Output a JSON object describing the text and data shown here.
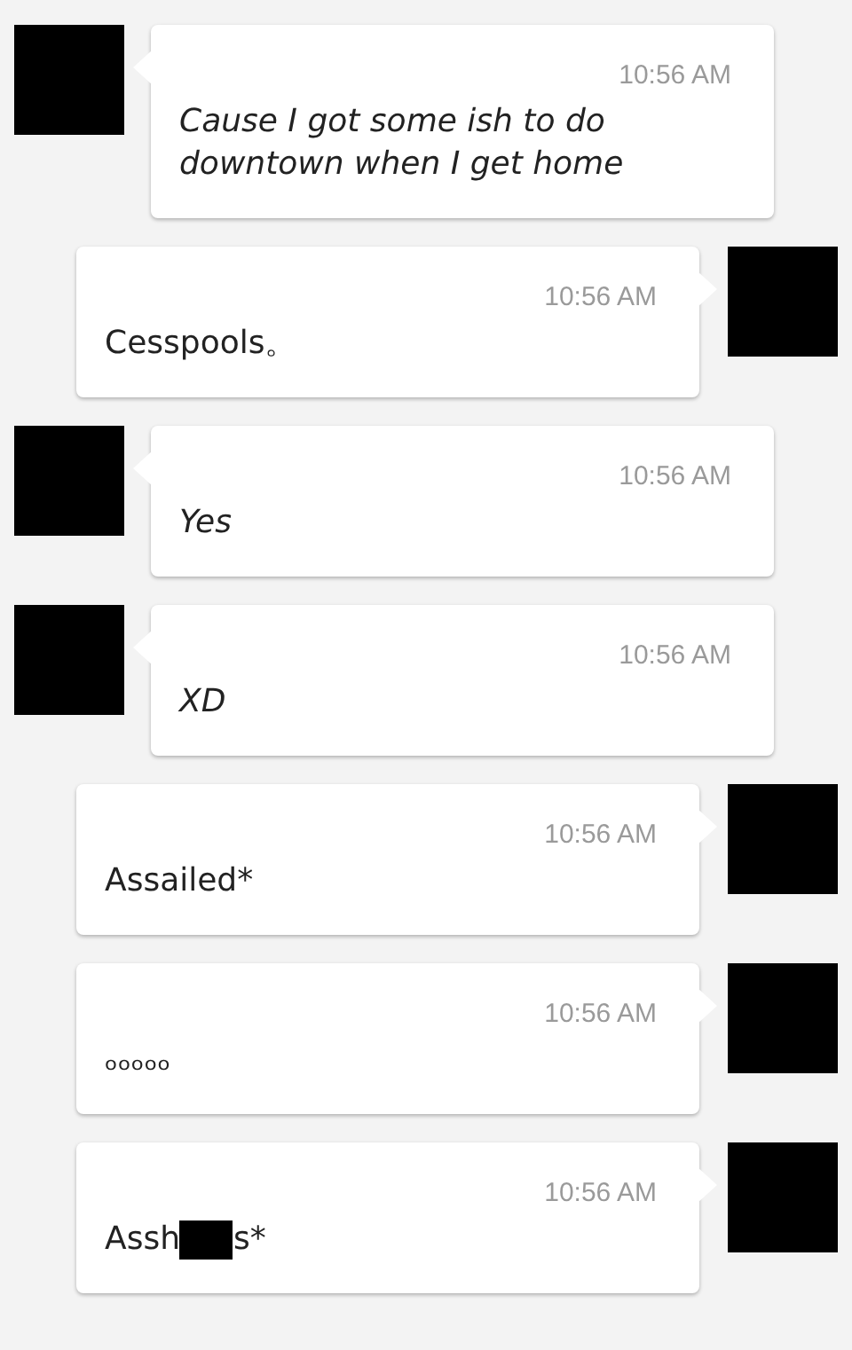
{
  "messages": [
    {
      "kind": "incoming",
      "time": "10:56 AM",
      "parts": [
        {
          "kind": "text",
          "text": "Cause I got some ish to do downtown when I get home"
        }
      ]
    },
    {
      "kind": "outgoing",
      "time": "10:56 AM",
      "parts": [
        {
          "kind": "text",
          "text": "Cesspools。"
        }
      ]
    },
    {
      "kind": "incoming",
      "time": "10:56 AM",
      "parts": [
        {
          "kind": "text",
          "text": "Yes"
        }
      ]
    },
    {
      "kind": "incoming",
      "time": "10:56 AM",
      "parts": [
        {
          "kind": "text",
          "text": "XD"
        }
      ]
    },
    {
      "kind": "outgoing",
      "time": "10:56 AM",
      "parts": [
        {
          "kind": "text",
          "text": "Assailed*"
        }
      ]
    },
    {
      "kind": "outgoing",
      "time": "10:56 AM",
      "parts": [
        {
          "kind": "text",
          "text": "ₒₒₒₒₒ"
        }
      ]
    },
    {
      "kind": "outgoing",
      "time": "10:56 AM",
      "parts": [
        {
          "kind": "text",
          "text": "Assh"
        },
        {
          "kind": "redaction"
        },
        {
          "kind": "text",
          "text": "s*"
        }
      ]
    }
  ]
}
